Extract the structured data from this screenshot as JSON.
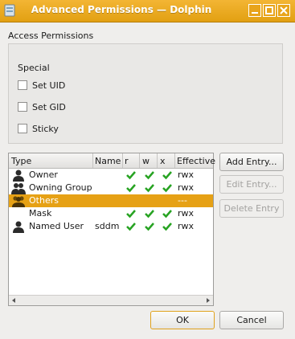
{
  "window": {
    "title": "Advanced Permissions — Dolphin",
    "controls": {
      "minimize": "minimize-icon",
      "maximize": "maximize-icon",
      "close": "close-icon"
    }
  },
  "access": {
    "group_title": "Access Permissions",
    "special_label": "Special",
    "checkboxes": [
      {
        "label": "Set UID",
        "checked": false
      },
      {
        "label": "Set GID",
        "checked": false
      },
      {
        "label": "Sticky",
        "checked": false
      }
    ]
  },
  "table": {
    "headers": [
      "Type",
      "Name",
      "r",
      "w",
      "x",
      "Effective"
    ],
    "rows": [
      {
        "type": "Owner",
        "name": "",
        "r": true,
        "w": true,
        "x": true,
        "effective": "rwx",
        "icon": "single-user-icon",
        "selected": false
      },
      {
        "type": "Owning Group",
        "name": "",
        "r": true,
        "w": true,
        "x": true,
        "effective": "rwx",
        "icon": "group-icon",
        "selected": false
      },
      {
        "type": "Others",
        "name": "",
        "r": false,
        "w": false,
        "x": false,
        "effective": "---",
        "icon": "others-icon",
        "selected": true
      },
      {
        "type": "Mask",
        "name": "",
        "r": true,
        "w": true,
        "x": true,
        "effective": "rwx",
        "icon": "mask-icon",
        "selected": false
      },
      {
        "type": "Named User",
        "name": "sddm",
        "r": true,
        "w": true,
        "x": true,
        "effective": "rwx",
        "icon": "single-user-icon",
        "selected": false
      }
    ]
  },
  "buttons": {
    "add_entry": "Add Entry...",
    "edit_entry": "Edit Entry...",
    "delete_entry": "Delete Entry",
    "ok": "OK",
    "cancel": "Cancel"
  },
  "colors": {
    "accent": "#e6a115",
    "check": "#27a322"
  }
}
